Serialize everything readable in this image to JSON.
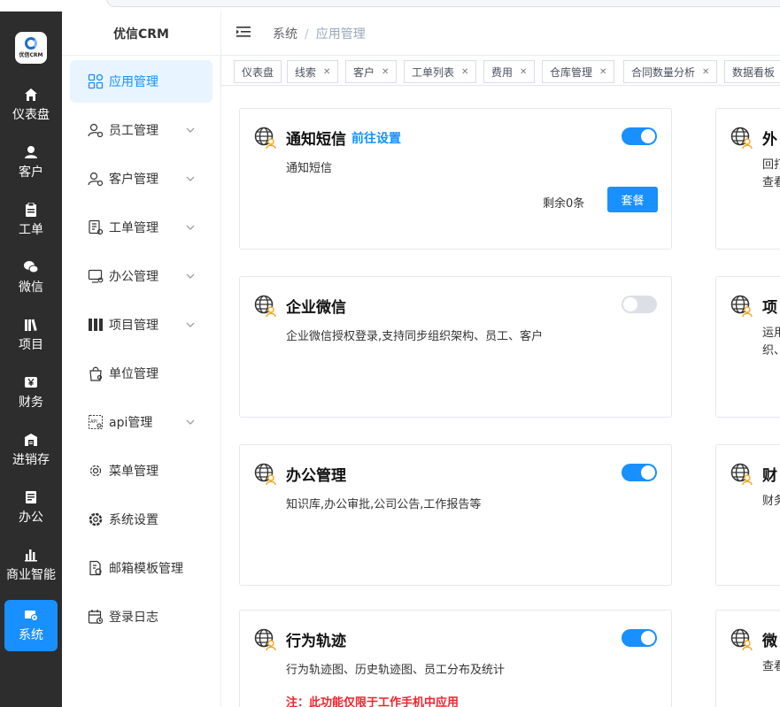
{
  "rail": {
    "logo_text": "优信CRM",
    "items": [
      {
        "label": "仪表盘",
        "icon": "home-icon"
      },
      {
        "label": "客户",
        "icon": "user-icon"
      },
      {
        "label": "工单",
        "icon": "clipboard-icon"
      },
      {
        "label": "微信",
        "icon": "wechat-icon"
      },
      {
        "label": "项目",
        "icon": "library-icon"
      },
      {
        "label": "财务",
        "icon": "yen-icon"
      },
      {
        "label": "进销存",
        "icon": "warehouse-icon"
      },
      {
        "label": "办公",
        "icon": "document-icon"
      },
      {
        "label": "商业智能",
        "icon": "bar-chart-icon"
      },
      {
        "label": "系统",
        "icon": "system-icon"
      }
    ],
    "active_index": 9
  },
  "sidebar": {
    "brand": "优信CRM",
    "items": [
      {
        "label": "应用管理",
        "icon": "apps-icon",
        "expandable": false,
        "active": true
      },
      {
        "label": "员工管理",
        "icon": "user-settings-icon",
        "expandable": true
      },
      {
        "label": "客户管理",
        "icon": "customer-settings-icon",
        "expandable": true
      },
      {
        "label": "工单管理",
        "icon": "ticket-settings-icon",
        "expandable": true
      },
      {
        "label": "办公管理",
        "icon": "monitor-settings-icon",
        "expandable": true
      },
      {
        "label": "项目管理",
        "icon": "project-icon",
        "expandable": true
      },
      {
        "label": "单位管理",
        "icon": "bag-icon",
        "expandable": false
      },
      {
        "label": "api管理",
        "icon": "api-icon",
        "expandable": true
      },
      {
        "label": "菜单管理",
        "icon": "gear-outline-icon",
        "expandable": false
      },
      {
        "label": "系统设置",
        "icon": "gear-icon",
        "expandable": false
      },
      {
        "label": "邮箱模板管理",
        "icon": "mail-template-icon",
        "expandable": false
      },
      {
        "label": "登录日志",
        "icon": "calendar-log-icon",
        "expandable": false
      }
    ]
  },
  "header": {
    "breadcrumb": [
      "系统",
      "应用管理"
    ]
  },
  "tags": [
    {
      "label": "仪表盘",
      "closable": false
    },
    {
      "label": "线索",
      "closable": true
    },
    {
      "label": "客户",
      "closable": true
    },
    {
      "label": "工单列表",
      "closable": true
    },
    {
      "label": "费用",
      "closable": true
    },
    {
      "label": "仓库管理",
      "closable": true
    },
    {
      "label": "合同数量分析",
      "closable": true
    },
    {
      "label": "数据看板",
      "closable": false
    }
  ],
  "cards": [
    {
      "title": "通知短信",
      "link": "前往设置",
      "desc": "通知短信",
      "enabled": true,
      "remain": "剩余0条",
      "button": "套餐"
    },
    {
      "title": "企业微信",
      "desc": "企业微信授权登录,支持同步组织架构、员工、客户",
      "enabled": false
    },
    {
      "title": "办公管理",
      "desc": "知识库,办公审批,公司公告,工作报告等",
      "enabled": true
    },
    {
      "title": "行为轨迹",
      "desc": "行为轨迹图、历史轨迹图、员工分布及统计",
      "enabled": true,
      "note": "注：此功能仅限于工作手机中应用"
    }
  ],
  "right_cards": [
    {
      "title": "外",
      "desc": "回打查看"
    },
    {
      "title": "项",
      "desc": "运用织、"
    },
    {
      "title": "财",
      "desc": "财务"
    },
    {
      "title": "微",
      "desc": "查看"
    }
  ],
  "colors": {
    "accent": "#1890ff",
    "rail_bg": "#2d2d2d",
    "warning": "#f5222d",
    "globe": "#f5a623"
  }
}
